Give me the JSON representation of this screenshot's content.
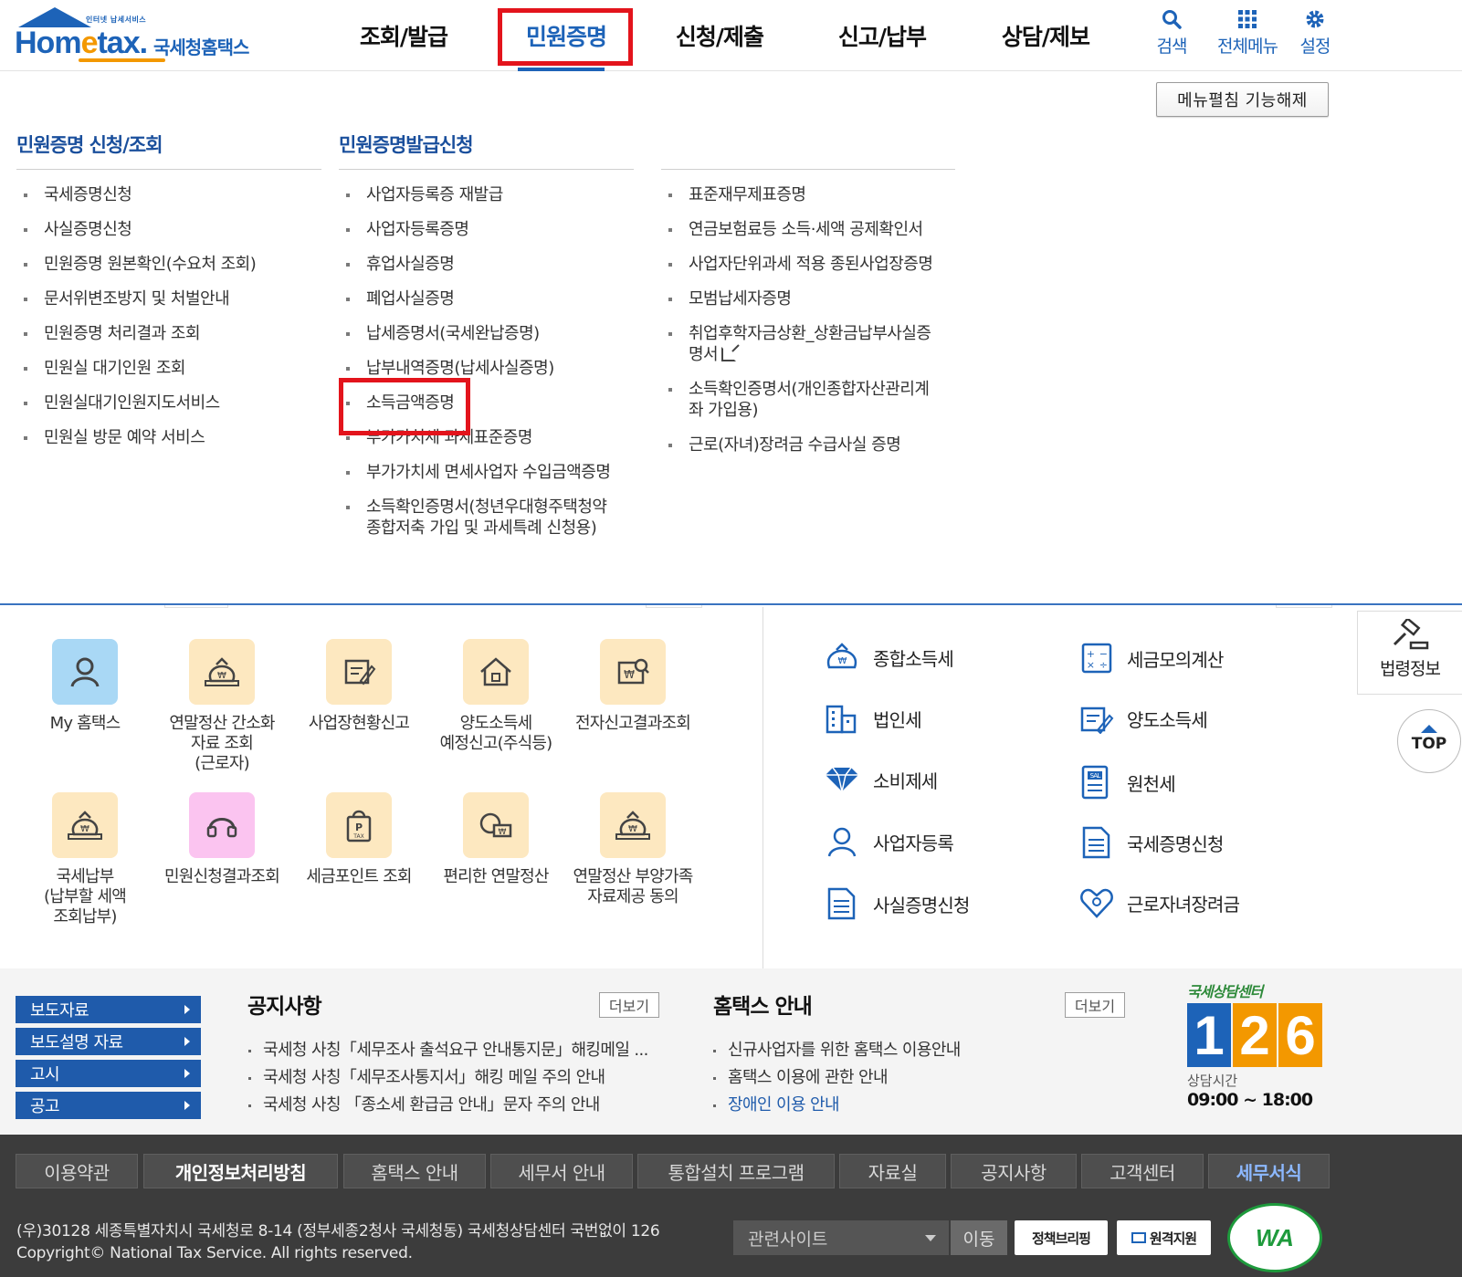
{
  "logo": {
    "top_text": "인터넷 납세서비스",
    "main_a": "Hom",
    "main_b": "e",
    "main_c": "tax.",
    "kor": "국세청홈택스"
  },
  "gnb": [
    {
      "label": "조회/발급"
    },
    {
      "label": "민원증명",
      "active": true
    },
    {
      "label": "신청/제출"
    },
    {
      "label": "신고/납부"
    },
    {
      "label": "상담/제보"
    }
  ],
  "utility": {
    "search": "검색",
    "all_menu": "전체메뉴",
    "settings": "설정"
  },
  "fold_button": "메뉴펼침 기능해제",
  "mega_menu": {
    "col1_title": "민원증명 신청/조회",
    "col1_items": [
      "국세증명신청",
      "사실증명신청",
      "민원증명 원본확인(수요처 조회)",
      "문서위변조방지 및 처벌안내",
      "민원증명 처리결과 조회",
      "민원실 대기인원 조회",
      "민원실대기인원지도서비스",
      "민원실 방문 예약 서비스"
    ],
    "col2_title": "민원증명발급신청",
    "col2_items": [
      "사업자등록증 재발급",
      "사업자등록증명",
      "휴업사실증명",
      "폐업사실증명",
      "납세증명서(국세완납증명)",
      "납부내역증명(납세사실증명)",
      "소득금액증명",
      "부가가치세 과세표준증명",
      "부가가치세 면세사업자 수입금액증명",
      "소득확인증명서(청년우대형주택청약",
      "종합저축 가입 및 과세특례 신청용)"
    ],
    "col3_items": [
      "표준재무제표증명",
      "연금보험료등 소득·세액 공제확인서",
      "사업자단위과세 적용 종된사업장증명",
      "모범납세자증명",
      "취업후학자금상환_상환금납부사실증",
      "명서",
      "소득확인증명서(개인종합자산관리계",
      "좌 가입용)",
      "근로(자녀)장려금 수급사실 증명"
    ]
  },
  "quick_icons": [
    {
      "label": "My 홈택스"
    },
    {
      "label": "연말정산 간소화\n자료 조회\n(근로자)"
    },
    {
      "label": "사업장현황신고"
    },
    {
      "label": "양도소득세\n예정신고(주식등)"
    },
    {
      "label": "전자신고결과조회"
    },
    {
      "label": "국세납부\n(납부할 세액\n조회납부)"
    },
    {
      "label": "민원신청결과조회"
    },
    {
      "label": "세금포인트 조회"
    },
    {
      "label": "편리한 연말정산"
    },
    {
      "label": "연말정산 부양가족\n자료제공 동의"
    }
  ],
  "tax_services": [
    "종합소득세",
    "세금모의계산",
    "법인세",
    "양도소득세",
    "소비제세",
    "원천세",
    "사업자등록",
    "국세증명신청",
    "사실증명신청",
    "근로자녀장려금"
  ],
  "side": {
    "law": "법령정보",
    "top": "TOP"
  },
  "press_buttons": [
    "보도자료",
    "보도설명 자료",
    "고시",
    "공고"
  ],
  "notice": {
    "title": "공지사항",
    "more": "더보기",
    "items": [
      "국세청 사칭「세무조사 출석요구 안내통지문」해킹메일 ...",
      "국세청 사칭「세무조사통지서」해킹 메일 주의 안내",
      "국세청 사칭 「종소세 환급금 안내」문자 주의 안내"
    ]
  },
  "hometax_guide": {
    "title": "홈택스 안내",
    "more": "더보기",
    "items": [
      "신규사업자를 위한 홈택스 이용안내",
      "홈택스 이용에 관한 안내",
      "장애인 이용 안내"
    ]
  },
  "center126": {
    "top": "국세상담센터",
    "d1": "1",
    "d2": "2",
    "d3": "6",
    "time_label": "상담시간",
    "time": "09:00 ~ 18:00"
  },
  "footer": {
    "links": [
      "이용약관",
      "개인정보처리방침",
      "홈택스 안내",
      "세무서 안내",
      "통합설치 프로그램",
      "자료실",
      "공지사항",
      "고객센터",
      "세무서식"
    ],
    "address": "(우)30128 세종특별자치시 국세청로 8-14 (정부세종2청사 국세청동) 국세청상담센터 국번없이 126",
    "copyright": "Copyright© National Tax Service. All rights reserved.",
    "related_sites": "관련사이트",
    "go": "이동",
    "badge1": "정책브리핑",
    "badge2": "원격지원",
    "wa": "WA"
  },
  "colors": {
    "brand_blue": "#1d63b8",
    "highlight_red": "#e3141c",
    "footer_bg": "#3c3c3c"
  }
}
